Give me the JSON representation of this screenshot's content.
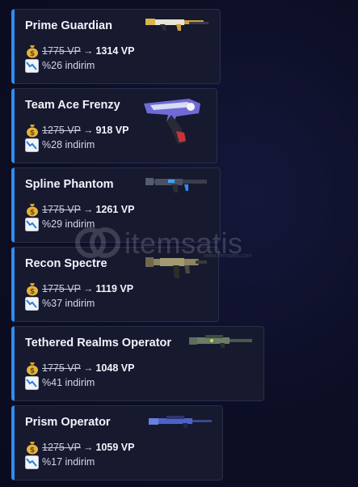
{
  "cards": [
    {
      "name": "Prime Guardian",
      "old_price": "1775 VP",
      "new_price": "1314 VP",
      "discount": "%26 indirim"
    },
    {
      "name": "Team Ace Frenzy",
      "old_price": "1275 VP",
      "new_price": "918 VP",
      "discount": "%28 indirim"
    },
    {
      "name": "Spline Phantom",
      "old_price": "1775 VP",
      "new_price": "1261 VP",
      "discount": "%29 indirim"
    },
    {
      "name": "Recon Spectre",
      "old_price": "1775 VP",
      "new_price": "1119 VP",
      "discount": "%37 indirim"
    },
    {
      "name": "Tethered Realms Operator",
      "old_price": "1775 VP",
      "new_price": "1048 VP",
      "discount": "%41 indirim"
    },
    {
      "name": "Prism Operator",
      "old_price": "1275 VP",
      "new_price": "1059 VP",
      "discount": "%17 indirim"
    }
  ],
  "price_arrow": "→",
  "watermark": {
    "text": "itemsatis",
    "sub": "www.itemsatis.com"
  },
  "colors": {
    "accent": "#2f8cf0",
    "card_bg": "#17192f",
    "page_bg": "#0d0f26"
  }
}
